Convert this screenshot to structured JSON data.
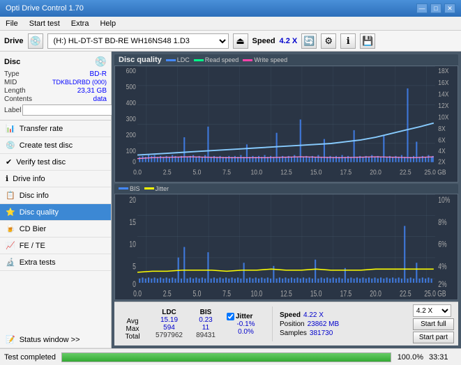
{
  "app": {
    "title": "Opti Drive Control 1.70",
    "title_full": "Opti Drive Control 1.70"
  },
  "titlebar": {
    "title": "Opti Drive Control 1.70",
    "minimize": "—",
    "maximize": "□",
    "close": "✕"
  },
  "menubar": {
    "items": [
      "File",
      "Start test",
      "Extra",
      "Help"
    ]
  },
  "drive_toolbar": {
    "drive_label": "Drive",
    "drive_value": "(H:) HL-DT-ST BD-RE  WH16NS48 1.D3",
    "speed_label": "Speed",
    "speed_value": "4.2 X"
  },
  "disc": {
    "title": "Disc",
    "type_label": "Type",
    "type_val": "BD-R",
    "mid_label": "MID",
    "mid_val": "TDKBLDRBD (000)",
    "length_label": "Length",
    "length_val": "23,31 GB",
    "contents_label": "Contents",
    "contents_val": "data",
    "label_label": "Label",
    "label_val": ""
  },
  "nav": {
    "items": [
      {
        "id": "transfer-rate",
        "label": "Transfer rate",
        "icon": "📊"
      },
      {
        "id": "create-test-disc",
        "label": "Create test disc",
        "icon": "💿"
      },
      {
        "id": "verify-test-disc",
        "label": "Verify test disc",
        "icon": "✔"
      },
      {
        "id": "drive-info",
        "label": "Drive info",
        "icon": "ℹ"
      },
      {
        "id": "disc-info",
        "label": "Disc info",
        "icon": "📋"
      },
      {
        "id": "disc-quality",
        "label": "Disc quality",
        "icon": "⭐",
        "active": true
      },
      {
        "id": "cd-bier",
        "label": "CD Bier",
        "icon": "🍺"
      },
      {
        "id": "fe-te",
        "label": "FE / TE",
        "icon": "📈"
      },
      {
        "id": "extra-tests",
        "label": "Extra tests",
        "icon": "🔬"
      }
    ]
  },
  "chart1": {
    "title": "Disc quality",
    "legend": [
      {
        "label": "LDC",
        "color": "#4488ff"
      },
      {
        "label": "Read speed",
        "color": "#00ff88"
      },
      {
        "label": "Write speed",
        "color": "#ff44aa"
      }
    ],
    "y_left_labels": [
      "600",
      "500",
      "400",
      "300",
      "200",
      "100",
      "0"
    ],
    "y_right_labels": [
      "18X",
      "16X",
      "14X",
      "12X",
      "10X",
      "8X",
      "6X",
      "4X",
      "2X"
    ],
    "x_labels": [
      "0.0",
      "2.5",
      "5.0",
      "7.5",
      "10.0",
      "12.5",
      "15.0",
      "17.5",
      "20.0",
      "22.5",
      "25.0 GB"
    ]
  },
  "chart2": {
    "legend": [
      {
        "label": "BIS",
        "color": "#4488ff"
      },
      {
        "label": "Jitter",
        "color": "#ffff00"
      }
    ],
    "y_left_labels": [
      "20",
      "15",
      "10",
      "5",
      "0"
    ],
    "y_right_labels": [
      "10%",
      "8%",
      "6%",
      "4%",
      "2%"
    ],
    "x_labels": [
      "0.0",
      "2.5",
      "5.0",
      "7.5",
      "10.0",
      "12.5",
      "15.0",
      "17.5",
      "20.0",
      "22.5",
      "25.0 GB"
    ]
  },
  "stats": {
    "ldc_label": "LDC",
    "bis_label": "BIS",
    "jitter_label": "Jitter",
    "speed_label": "Speed",
    "avg_label": "Avg",
    "max_label": "Max",
    "total_label": "Total",
    "ldc_avg": "15.19",
    "ldc_max": "594",
    "ldc_total": "5797962",
    "bis_avg": "0.23",
    "bis_max": "11",
    "bis_total": "89431",
    "jitter_avg": "-0.1%",
    "jitter_max": "0.0%",
    "speed_val": "4.22 X",
    "position_label": "Position",
    "position_val": "23862 MB",
    "samples_label": "Samples",
    "samples_val": "381730",
    "speed_dropdown": "4.2 X"
  },
  "buttons": {
    "start_full": "Start full",
    "start_part": "Start part"
  },
  "statusbar": {
    "text": "Test completed",
    "progress": 100,
    "progress_label": "100.0%",
    "time": "33:31"
  },
  "status_window": {
    "label": "Status window >>"
  }
}
